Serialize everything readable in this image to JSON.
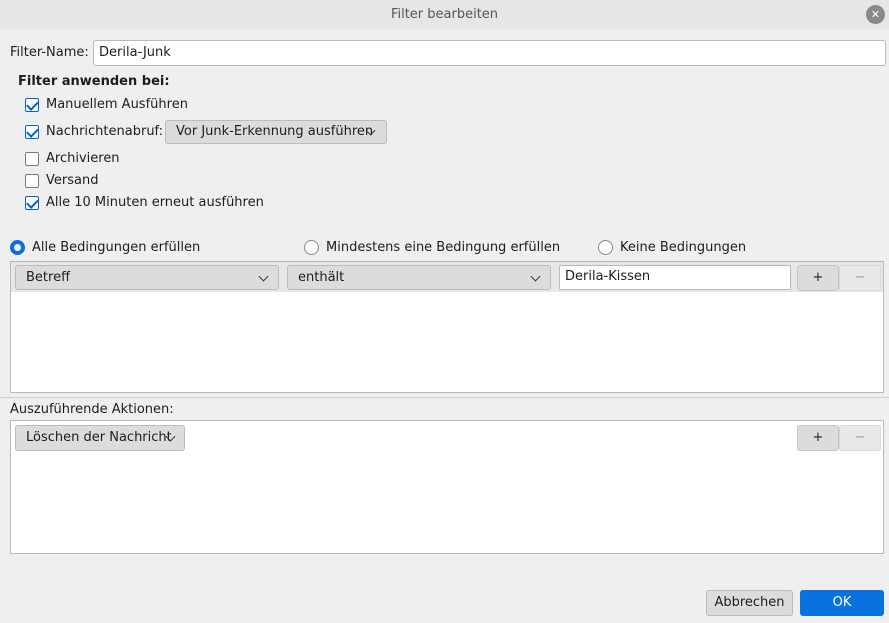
{
  "window": {
    "title": "Filter bearbeiten"
  },
  "filter_name": {
    "label": "Filter-Name:",
    "value": "Derila-Junk"
  },
  "apply_when": {
    "heading": "Filter anwenden bei:",
    "options": [
      {
        "label": "Manuellem Ausführen",
        "checked": true
      },
      {
        "label": "Nachrichtenabruf:",
        "checked": true
      },
      {
        "label": "Archivieren",
        "checked": false
      },
      {
        "label": "Versand",
        "checked": false
      },
      {
        "label": "Alle 10 Minuten erneut ausführen",
        "checked": true
      }
    ],
    "retrieval_select": "Vor Junk-Erkennung ausführen"
  },
  "match_mode": {
    "options": [
      {
        "label": "Alle Bedingungen erfüllen",
        "selected": true
      },
      {
        "label": "Mindestens eine Bedingung erfüllen",
        "selected": false
      },
      {
        "label": "Keine Bedingungen",
        "selected": false
      }
    ]
  },
  "conditions": [
    {
      "field": "Betreff",
      "operator": "enthält",
      "value": "Derila-Kissen",
      "add": "+",
      "remove": "−"
    }
  ],
  "actions": {
    "label": "Auszuführende Aktionen:",
    "items": [
      {
        "action": "Löschen der Nachricht",
        "add": "+",
        "remove": "−"
      }
    ]
  },
  "footer": {
    "cancel": "Abbrechen",
    "ok": "OK"
  },
  "colors": {
    "accent": "#0a72de",
    "check": "#0063d1"
  }
}
